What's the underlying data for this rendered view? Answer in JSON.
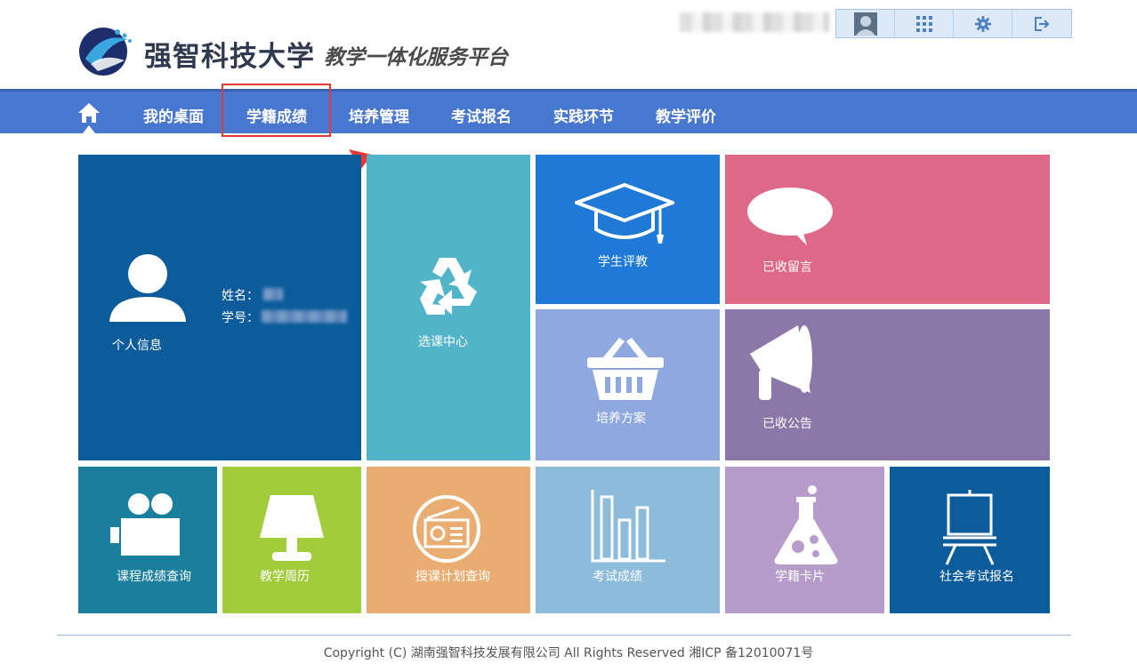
{
  "header": {
    "brand_title": "强智科技大学",
    "brand_subtitle": "教学一体化服务平台"
  },
  "toolbar": {
    "icons": [
      "avatar",
      "grid-icon",
      "gear-icon",
      "logout-icon"
    ]
  },
  "nav": {
    "items": [
      "我的桌面",
      "学籍成绩",
      "培养管理",
      "考试报名",
      "实践环节",
      "教学评价"
    ],
    "highlighted": "学籍成绩"
  },
  "profile": {
    "title": "个人信息",
    "name_label": "姓名：",
    "id_label": "学号："
  },
  "tiles": {
    "course_select": "选课中心",
    "student_eval": "学生评教",
    "messages": "已收留言",
    "training_plan": "培养方案",
    "announcements": "已收公告",
    "grade_query": "课程成绩查询",
    "calendar": "教学周历",
    "lesson_plan": "授课计划查询",
    "exam_scores": "考试成绩",
    "student_card": "学籍卡片",
    "social_exam": "社会考试报名"
  },
  "colors": {
    "nav": "#4877cf",
    "profile": "#0c5b9b",
    "course_select": "#52b4c8",
    "student_eval": "#1e7ad6",
    "messages": "#de6887",
    "training_plan": "#8fa8e0",
    "announcements": "#8c78a8",
    "grade_query": "#1a7f9c",
    "calendar": "#a3cc3d",
    "lesson_plan": "#e9ad72",
    "exam_scores": "#8cbbdb",
    "student_card": "#b79ccb",
    "social_exam": "#0c5b9b"
  },
  "footer": {
    "text": "Copyright (C) 湖南强智科技发展有限公司 All Rights Reserved 湘ICP 备12010071号"
  }
}
